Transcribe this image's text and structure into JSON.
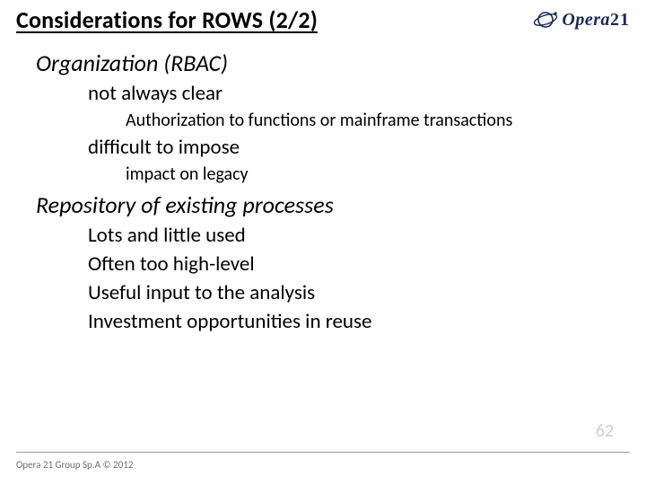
{
  "title": "Considerations for ROWS (2/2)",
  "logo": {
    "brand": "Opera",
    "suffix": "21"
  },
  "sections": [
    {
      "heading": "Organization (RBAC)",
      "items": [
        {
          "text": "not always clear",
          "sub": [
            "Authorization to functions or mainframe transactions"
          ]
        },
        {
          "text": "difficult to impose",
          "sub": [
            "impact on legacy"
          ]
        }
      ]
    },
    {
      "heading": "Repository of existing processes",
      "items": [
        {
          "text": "Lots and little used"
        },
        {
          "text": "Often too high-level"
        },
        {
          "text": "Useful input to the analysis"
        },
        {
          "text": "Investment opportunities in reuse"
        }
      ]
    }
  ],
  "page_number": "62",
  "footer": "Opera 21 Group Sp.A © 2012"
}
